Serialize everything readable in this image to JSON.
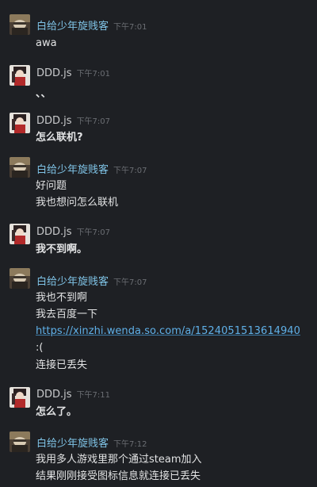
{
  "users": {
    "friend": {
      "name": "白给少年旋贱客",
      "name_color": "#7fc3e6"
    },
    "other": {
      "name": "DDD.js",
      "name_color": "#c9cacc"
    }
  },
  "colors": {
    "background": "#1e2024",
    "link": "#5fb0e8",
    "timestamp": "#6b6e73",
    "text": "#e2e3e4"
  },
  "messages": [
    {
      "sender": "白给少年旋贱客",
      "time": "下午7:01",
      "lines": [
        "awa"
      ]
    },
    {
      "sender": "DDD.js",
      "time": "下午7:01",
      "lines": [
        "、、"
      ]
    },
    {
      "sender": "DDD.js",
      "time": "下午7:07",
      "lines": [
        "怎么联机?"
      ]
    },
    {
      "sender": "白给少年旋贱客",
      "time": "下午7:07",
      "lines": [
        "好问题",
        "我也想问怎么联机"
      ]
    },
    {
      "sender": "DDD.js",
      "time": "下午7:07",
      "lines": [
        "我不到啊。"
      ]
    },
    {
      "sender": "白给少年旋贱客",
      "time": "下午7:07",
      "lines": [
        "我也不到啊",
        "我去百度一下",
        "https://xinzhi.wenda.so.com/a/1524051513614940",
        ":(",
        "连接已丢失"
      ]
    },
    {
      "sender": "DDD.js",
      "time": "下午7:11",
      "lines": [
        "怎么了。"
      ]
    },
    {
      "sender": "白给少年旋贱客",
      "time": "下午7:12",
      "lines": [
        "我用多人游戏里那个通过steam加入",
        "结果刚刚接受图标信息就连接已丢失"
      ]
    }
  ]
}
